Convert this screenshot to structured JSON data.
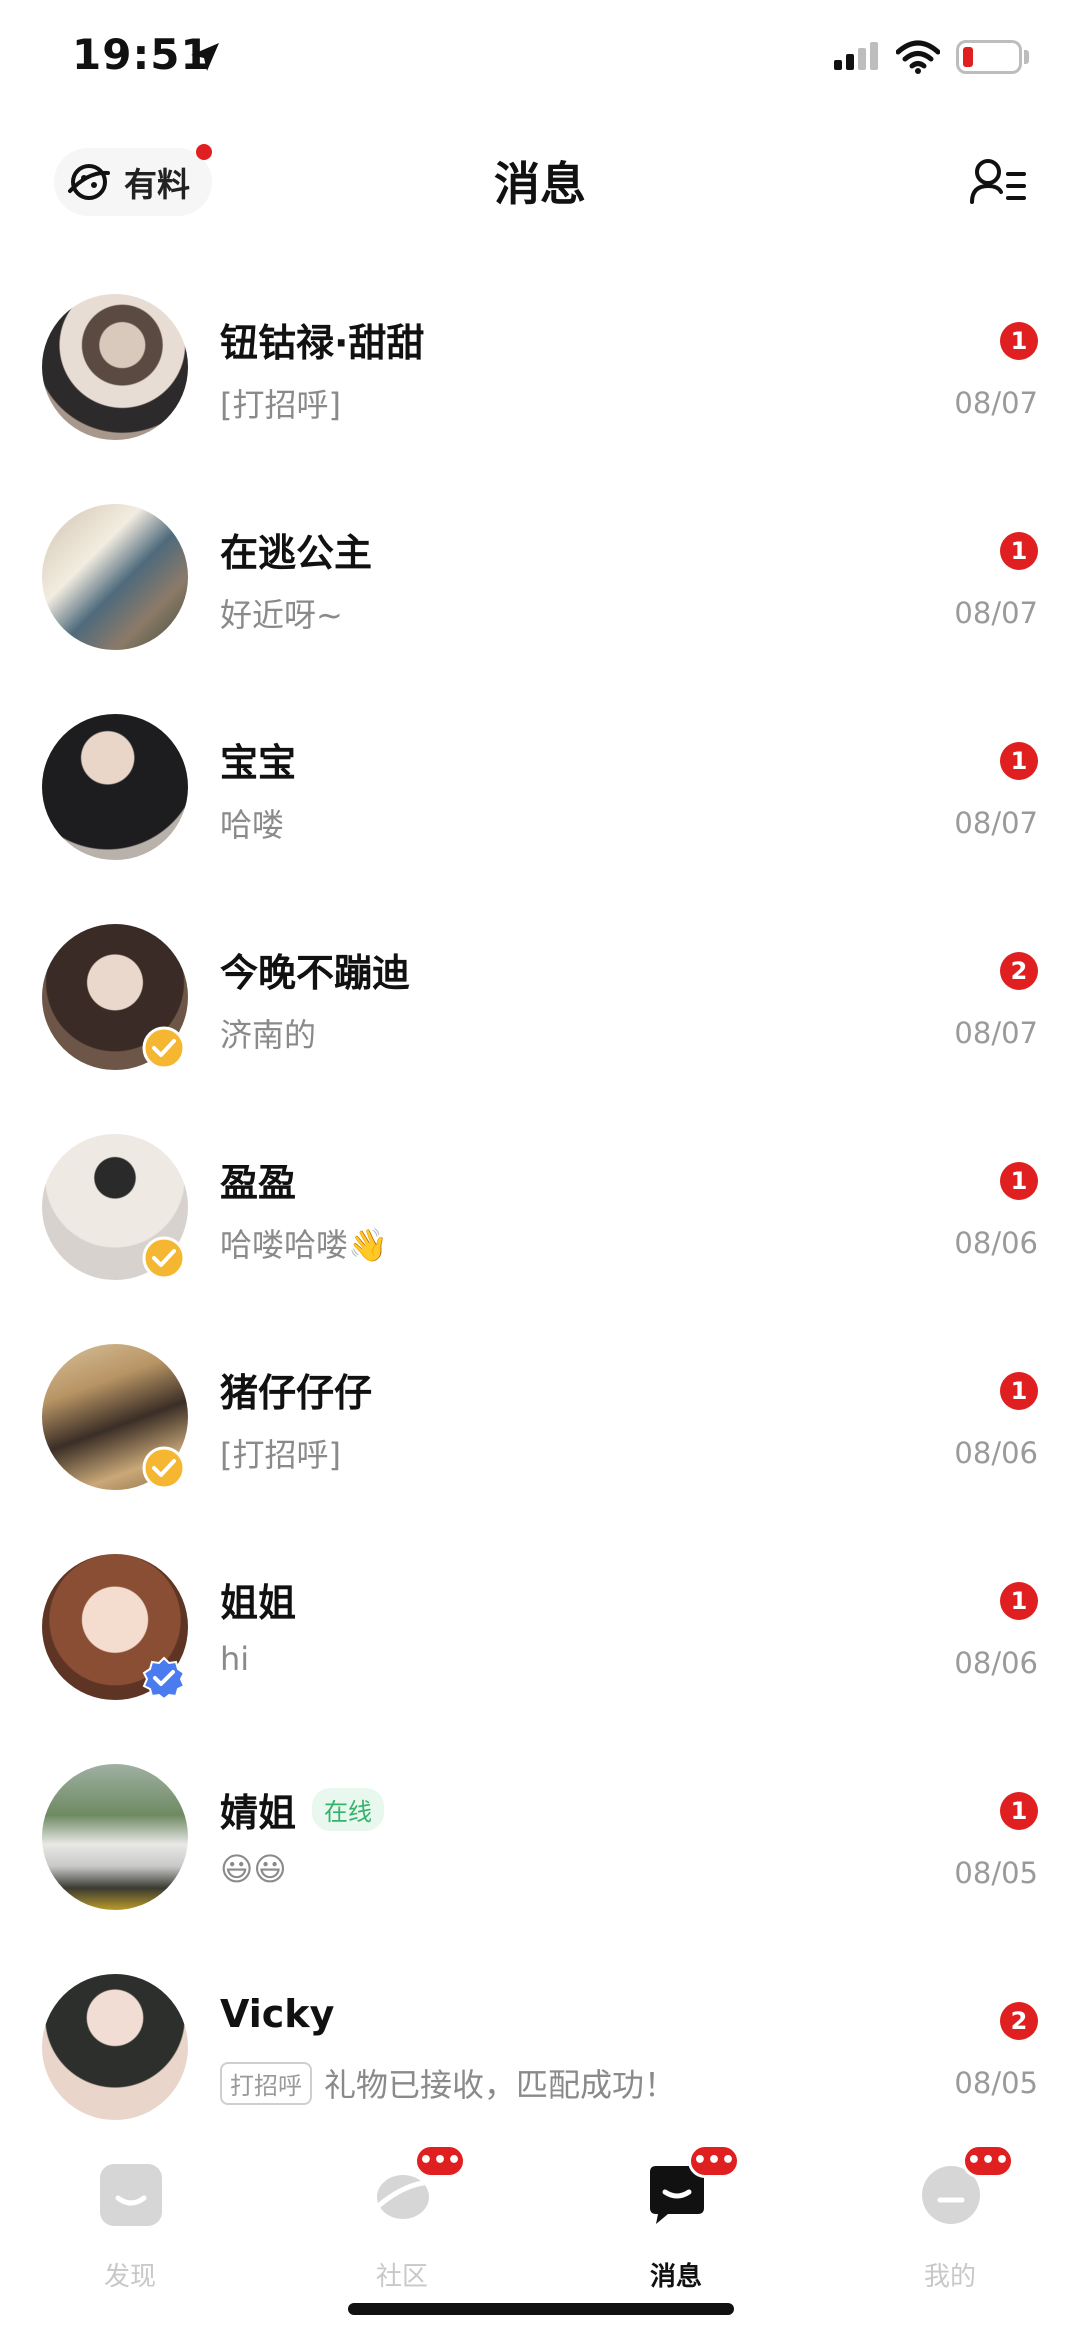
{
  "status_bar": {
    "time": "19:51"
  },
  "header": {
    "youliao_label": "有料",
    "title": "消息"
  },
  "conversations": [
    {
      "name": "钮钴禄·甜甜",
      "preview": "[打招呼]",
      "time": "08/07",
      "unread": "1",
      "verified": "none"
    },
    {
      "name": "在逃公主",
      "preview": "好近呀~",
      "time": "08/07",
      "unread": "1",
      "verified": "none"
    },
    {
      "name": "宝宝",
      "preview": "哈喽",
      "time": "08/07",
      "unread": "1",
      "verified": "none"
    },
    {
      "name": "今晚不蹦迪",
      "preview": "济南的",
      "time": "08/07",
      "unread": "2",
      "verified": "gold"
    },
    {
      "name": "盈盈",
      "preview": "哈喽哈喽👋",
      "time": "08/06",
      "unread": "1",
      "verified": "gold"
    },
    {
      "name": "猪仔仔仔",
      "preview": "[打招呼]",
      "time": "08/06",
      "unread": "1",
      "verified": "gold"
    },
    {
      "name": "姐姐",
      "preview": "hi",
      "time": "08/06",
      "unread": "1",
      "verified": "blue"
    },
    {
      "name": "婧姐",
      "online_tag": "在线",
      "preview": "😃😃",
      "time": "08/05",
      "unread": "1",
      "verified": "none"
    },
    {
      "name": "Vicky",
      "hello_tag": "打招呼",
      "preview": "礼物已接收，匹配成功！",
      "time": "08/05",
      "unread": "2",
      "verified": "none"
    }
  ],
  "tab_bar": {
    "tabs": [
      {
        "label": "发现",
        "icon": "discover-icon",
        "active": false,
        "badge": ""
      },
      {
        "label": "社区",
        "icon": "community-icon",
        "active": false,
        "badge": "•••"
      },
      {
        "label": "消息",
        "icon": "message-icon",
        "active": true,
        "badge": "•••"
      },
      {
        "label": "我的",
        "icon": "profile-icon",
        "active": false,
        "badge": "•••"
      }
    ]
  },
  "colors": {
    "accent_red": "#e02020",
    "online_green": "#35b36a",
    "verify_gold": "#f5b731",
    "verify_blue": "#4a7cf0"
  }
}
